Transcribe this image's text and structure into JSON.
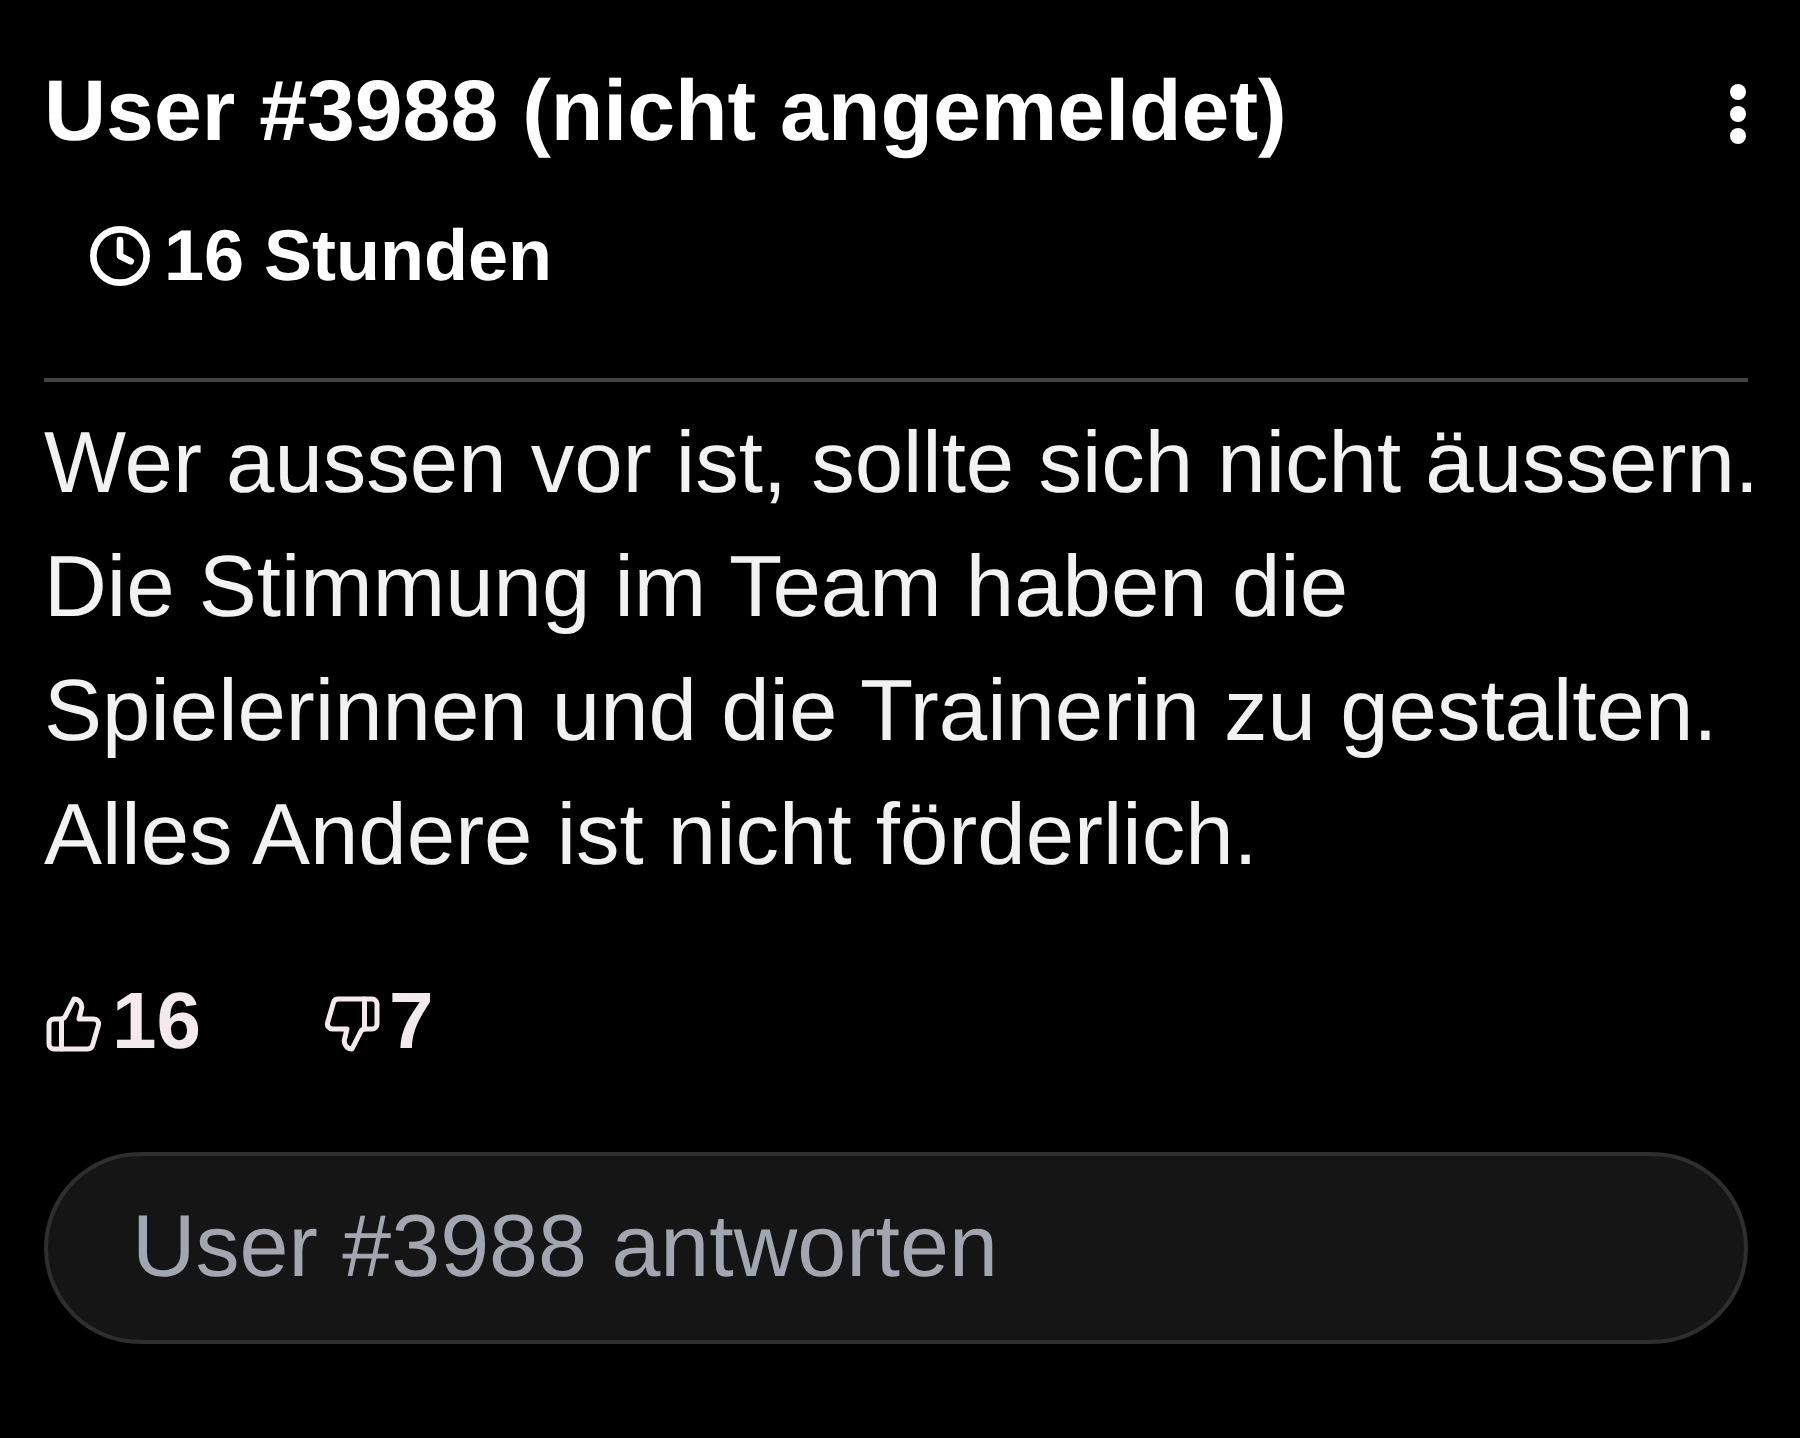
{
  "comment": {
    "author": "User #3988 (nicht angemeldet)",
    "time": "16 Stunden",
    "text": "Wer aussen vor ist, sollte sich nicht äussern. Die Stimmung im Team haben die Spielerinnen und die Trainerin zu gestalten. Alles Andere ist nicht förderlich.",
    "likes": "16",
    "dislikes": "7"
  },
  "reply": {
    "placeholder": "User #3988 antworten"
  }
}
